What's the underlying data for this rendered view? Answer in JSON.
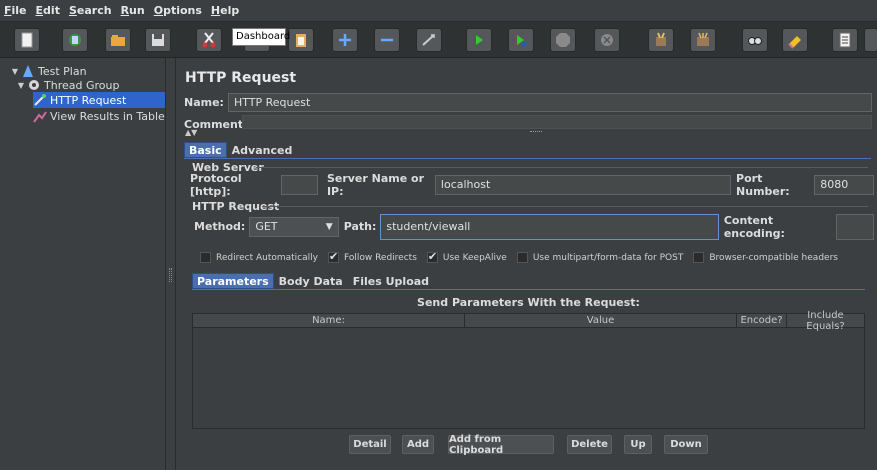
{
  "menu": [
    {
      "u": "F",
      "rest": "ile"
    },
    {
      "u": "E",
      "rest": "dit"
    },
    {
      "u": "S",
      "rest": "earch"
    },
    {
      "u": "R",
      "rest": "un"
    },
    {
      "u": "O",
      "rest": "ptions"
    },
    {
      "u": "H",
      "rest": "elp"
    }
  ],
  "tooltip": "Dashboard",
  "toolbar_icons": [
    "new-icon",
    "templates-icon",
    "open-icon",
    "save-icon",
    "cut-icon",
    "copy-icon",
    "paste-icon",
    "expand-icon",
    "collapse-icon",
    "toggle-icon",
    "start-icon",
    "start-no-pause-icon",
    "stop-icon",
    "shutdown-icon",
    "clear-icon",
    "clear-all-icon",
    "search-icon",
    "reset-search-icon",
    "function-helper-icon"
  ],
  "tree": {
    "items": [
      {
        "label": "Test Plan"
      },
      {
        "label": "Thread Group"
      },
      {
        "label": "HTTP Request"
      },
      {
        "label": "View Results in Table"
      }
    ]
  },
  "main": {
    "title": "HTTP Request",
    "name_label": "Name:",
    "name_value": "HTTP Request",
    "comments_label": "Comments:",
    "tabs": [
      "Basic",
      "Advanced"
    ],
    "web_server": {
      "title": "Web Server",
      "protocol_label": "Protocol [http]:",
      "protocol_value": "",
      "server_label": "Server Name or IP:",
      "server_value": "localhost",
      "port_label": "Port Number:",
      "port_value": "8080"
    },
    "http_request": {
      "title": "HTTP Request",
      "method_label": "Method:",
      "method_value": "GET",
      "path_label": "Path:",
      "path_value": "student/viewall",
      "encoding_label": "Content encoding:",
      "encoding_value": ""
    },
    "checkboxes": [
      {
        "label": "Redirect Automatically",
        "checked": false
      },
      {
        "label": "Follow Redirects",
        "checked": true
      },
      {
        "label": "Use KeepAlive",
        "checked": true
      },
      {
        "label": "Use multipart/form-data for POST",
        "checked": false
      },
      {
        "label": "Browser-compatible headers",
        "checked": false
      }
    ],
    "param_tabs": [
      "Parameters",
      "Body Data",
      "Files Upload"
    ],
    "table": {
      "caption": "Send Parameters With the Request:",
      "columns": [
        "Name:",
        "Value",
        "Encode?",
        "Include Equals?"
      ]
    },
    "buttons": [
      "Detail",
      "Add",
      "Add from Clipboard",
      "Delete",
      "Up",
      "Down"
    ]
  }
}
